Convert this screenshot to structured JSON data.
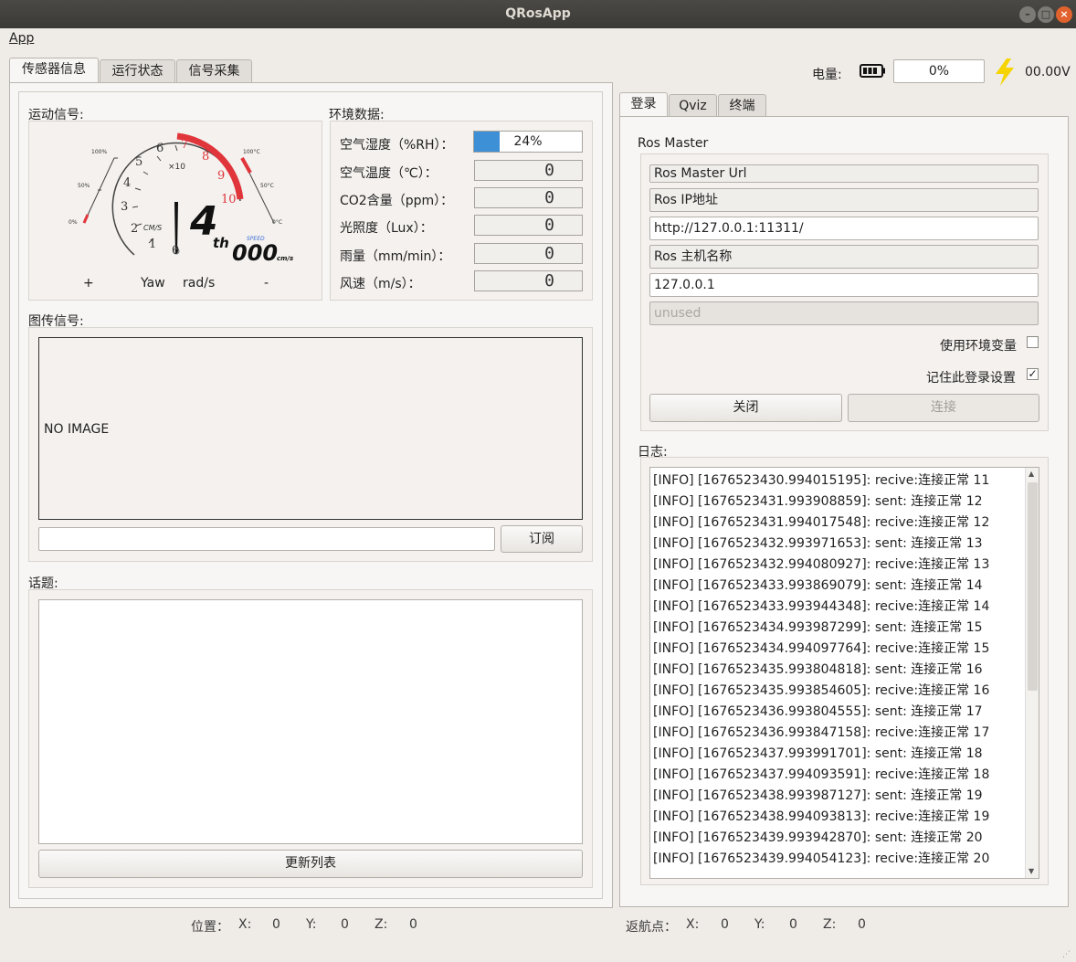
{
  "window": {
    "title": "QRosApp"
  },
  "menu": {
    "app": "App"
  },
  "left_tabs": [
    "传感器信息",
    "运行状态",
    "信号采集"
  ],
  "battery": {
    "label": "电量:",
    "percent": "0%",
    "voltage": "00.00V",
    "level": 0.0
  },
  "motion": {
    "title": "运动信号:",
    "gear": "4",
    "gear_suffix": "th",
    "speed": "000",
    "speed_unit": "cm/s",
    "speed_tag": "SPEED",
    "gauge_unit": "CM/S",
    "gauge_multiplier": "×10",
    "gauge_ticks": [
      "0",
      "1",
      "2",
      "3",
      "4",
      "5",
      "6",
      "7",
      "8",
      "9",
      "10"
    ],
    "left_scale": [
      "100%",
      "50%",
      "0%"
    ],
    "right_scale": [
      "100°C",
      "50°C",
      "0°C"
    ],
    "yaw": {
      "plus": "+",
      "label": "Yaw",
      "unit": "rad/s",
      "minus": "-"
    }
  },
  "env": {
    "title": "环境数据:",
    "rows": [
      {
        "label": "空气湿度（%RH）：",
        "value": "24%",
        "progress": 0.24
      },
      {
        "label": "空气温度（℃）：",
        "value": "0"
      },
      {
        "label": "CO2含量（ppm）：",
        "value": "0"
      },
      {
        "label": "光照度（Lux）：",
        "value": "0"
      },
      {
        "label": "雨量（mm/min）：",
        "value": "0"
      },
      {
        "label": "风速（m/s）：",
        "value": "0"
      }
    ]
  },
  "image": {
    "title": "图传信号:",
    "placeholder": "NO IMAGE",
    "topic_value": "",
    "subscribe_label": "订阅"
  },
  "topics": {
    "title": "话题:",
    "refresh_label": "更新列表"
  },
  "right_tabs": [
    "登录",
    "Qviz",
    "终端"
  ],
  "login": {
    "group_title": "Ros Master",
    "master_url_label": "Ros Master Url",
    "ip_label": "Ros IP地址",
    "master_url_value": "http://127.0.0.1:11311/",
    "hostname_label": "Ros 主机名称",
    "hostname_value": "127.0.0.1",
    "unused_value": "unused",
    "use_env_label": "使用环境变量",
    "use_env_checked": false,
    "remember_label": "记住此登录设置",
    "remember_checked": true,
    "remember_mark": "✓",
    "close_label": "关闭",
    "connect_label": "连接"
  },
  "log": {
    "title": "日志:",
    "lines": [
      "[INFO] [1676523430.994015195]: recive:连接正常 11",
      "[INFO] [1676523431.993908859]: sent: 连接正常 12",
      "[INFO] [1676523431.994017548]: recive:连接正常 12",
      "[INFO] [1676523432.993971653]: sent: 连接正常 13",
      "[INFO] [1676523432.994080927]: recive:连接正常 13",
      "[INFO] [1676523433.993869079]: sent: 连接正常 14",
      "[INFO] [1676523433.993944348]: recive:连接正常 14",
      "[INFO] [1676523434.993987299]: sent: 连接正常 15",
      "[INFO] [1676523434.994097764]: recive:连接正常 15",
      "[INFO] [1676523435.993804818]: sent: 连接正常 16",
      "[INFO] [1676523435.993854605]: recive:连接正常 16",
      "[INFO] [1676523436.993804555]: sent: 连接正常 17",
      "[INFO] [1676523436.993847158]: recive:连接正常 17",
      "[INFO] [1676523437.993991701]: sent: 连接正常 18",
      "[INFO] [1676523437.994093591]: recive:连接正常 18",
      "[INFO] [1676523438.993987127]: sent: 连接正常 19",
      "[INFO] [1676523438.994093813]: recive:连接正常 19",
      "[INFO] [1676523439.993942870]: sent: 连接正常 20",
      "[INFO] [1676523439.994054123]: recive:连接正常 20"
    ]
  },
  "status": {
    "position": {
      "label": "位置：",
      "x_label": "X:",
      "x": "0",
      "y_label": "Y:",
      "y": "0",
      "z_label": "Z:",
      "z": "0"
    },
    "home": {
      "label": "返航点：",
      "x_label": "X:",
      "x": "0",
      "y_label": "Y:",
      "y": "0",
      "z_label": "Z:",
      "z": "0"
    }
  },
  "colors": {
    "accent": "#3d8fd6",
    "redline": "#e0353b",
    "lightning": "#f5d400",
    "close": "#e2622e"
  }
}
